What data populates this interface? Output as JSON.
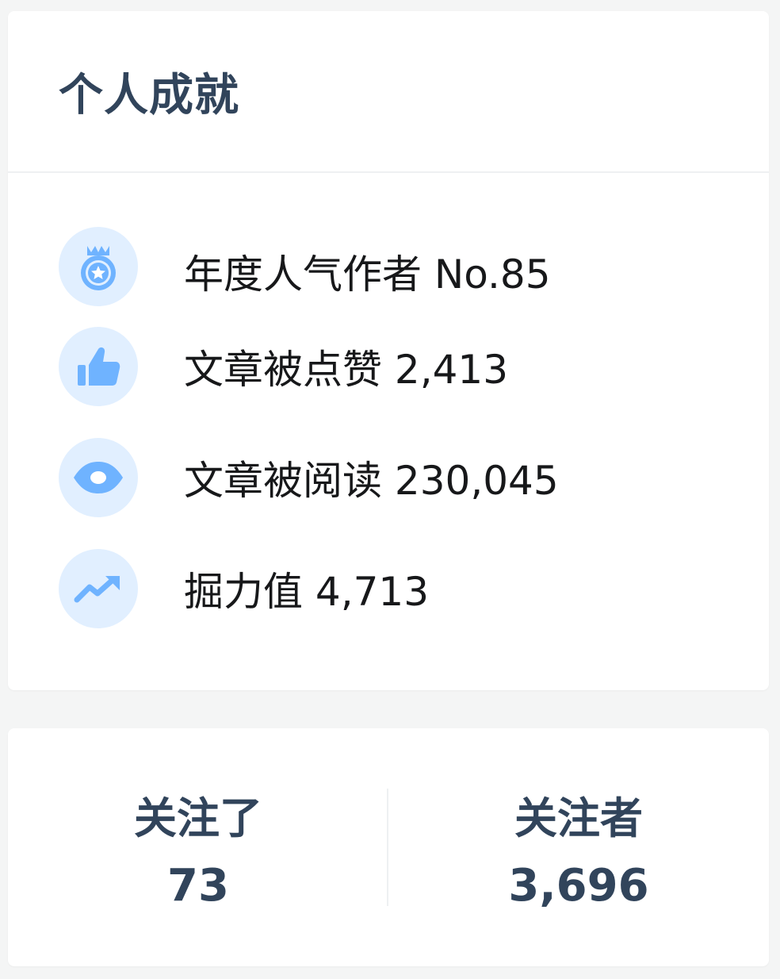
{
  "achievements": {
    "title": "个人成就",
    "items": [
      {
        "icon": "medal-icon",
        "text": "年度人气作者 No.85"
      },
      {
        "icon": "thumbs-up-icon",
        "text": "文章被点赞 2,413"
      },
      {
        "icon": "eye-icon",
        "text": "文章被阅读 230,045"
      },
      {
        "icon": "trend-up-icon",
        "text": "掘力值 4,713"
      }
    ]
  },
  "follow": {
    "following": {
      "label": "关注了",
      "count": "73"
    },
    "followers": {
      "label": "关注者",
      "count": "3,696"
    }
  },
  "colors": {
    "accent": "#6fb3ff",
    "icon_bg": "#e1efff",
    "title": "#31445b",
    "text": "#17181a",
    "page_bg": "#f4f5f5"
  }
}
